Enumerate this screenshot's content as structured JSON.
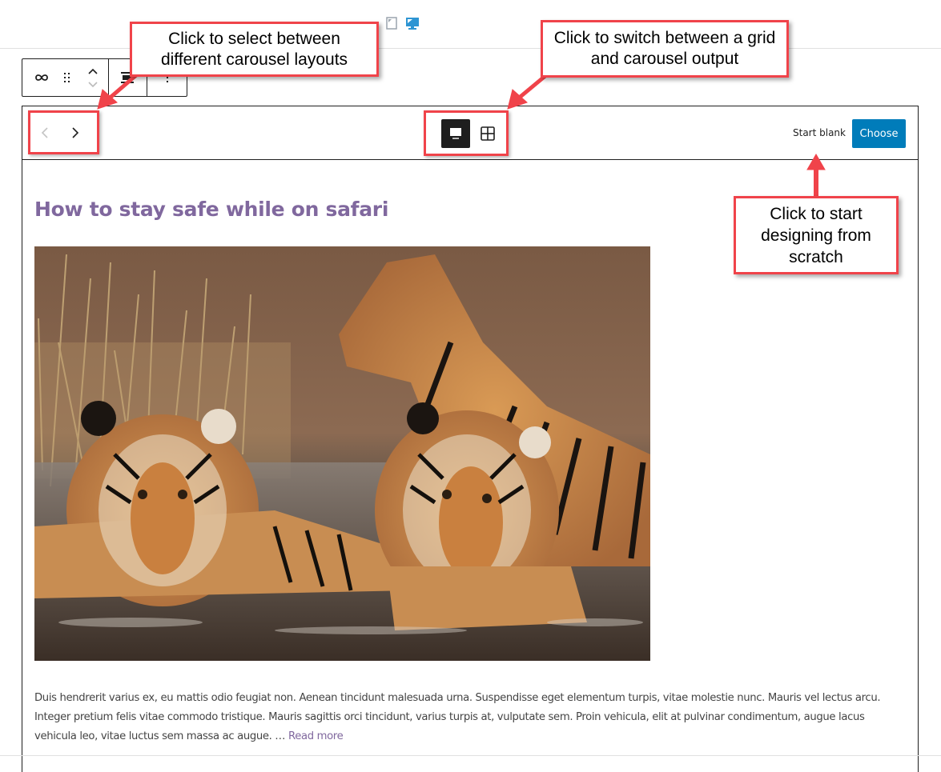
{
  "preview": {
    "devices": [
      {
        "name": "tablet",
        "icon": "tablet-icon",
        "active": false
      },
      {
        "name": "desktop",
        "icon": "desktop-icon",
        "active": true
      }
    ]
  },
  "toolbar": {
    "block_icon": "carousel-loop-icon",
    "drag_icon": "drag-handle-icon",
    "move_up_label": "Move up",
    "move_down_label": "Move down",
    "align_icon": "align-icon",
    "more_options_icon": "more-vertical-icon"
  },
  "block": {
    "nav": {
      "previous_icon": "chevron-left-icon",
      "next_icon": "chevron-right-icon",
      "previous_enabled": false,
      "next_enabled": true
    },
    "view_toggle": {
      "options": [
        "carousel",
        "grid"
      ],
      "selected": "carousel"
    },
    "start_blank_label": "Start blank",
    "choose_label": "Choose",
    "accent_color": "#007cba"
  },
  "post": {
    "title": "How to stay safe while on safari",
    "title_color": "#80689e",
    "image_alt": "Three tigers resting in a waterhole",
    "excerpt": "Duis hendrerit varius ex, eu mattis odio feugiat non. Aenean tincidunt malesuada urna. Suspendisse eget elementum turpis, vitae molestie nunc. Mauris vel lectus arcu. Integer pretium felis vitae commodo tristique. Mauris sagittis orci tincidunt, varius turpis at, vulputate sem. Proin vehicula, elit at pulvinar condimentum, augue lacus vehicula leo, vitae luctus sem massa ac augue. … ",
    "read_more_label": "Read more"
  },
  "callouts": {
    "layouts": "Click to select between different carousel layouts",
    "grid_carousel": "Click to switch between a grid and carousel output",
    "start_blank": "Click to start designing from scratch",
    "color": "#f0434a"
  }
}
